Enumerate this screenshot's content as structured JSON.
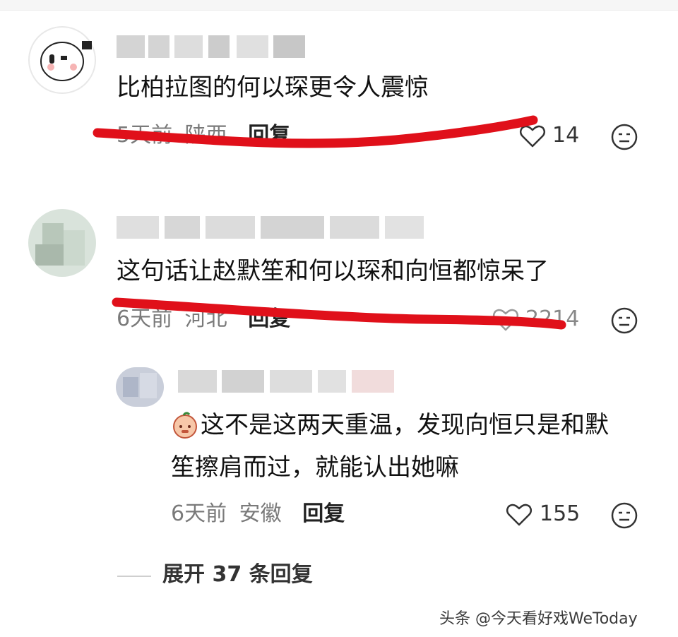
{
  "comments": [
    {
      "text": "比柏拉图的何以琛更令人震惊",
      "time": "5天前",
      "location": "陕西",
      "reply_label": "回复",
      "likes": "14",
      "like_icon": "heart-outline-icon",
      "emoji_icon": "emoji-face-icon"
    },
    {
      "text": "这句话让赵默笙和何以琛和向恒都惊呆了",
      "time": "6天前",
      "location": "河北",
      "reply_label": "回复",
      "likes": "2214",
      "like_icon": "heart-outline-icon",
      "emoji_icon": "emoji-face-icon"
    }
  ],
  "reply": {
    "text_line1": "这不是这两天重温，发现向恒只是和默",
    "text_line2": "笙擦肩而过，就能认出她嘛",
    "time": "6天前",
    "location": "安徽",
    "reply_label": "回复",
    "likes": "155",
    "like_icon": "heart-outline-icon",
    "emoji_icon": "emoji-face-icon",
    "sticker_icon": "peach-sticker-icon"
  },
  "expand_label": "展开 37 条回复",
  "watermark": "头条 @今天看好戏WeToday",
  "colors": {
    "annotation_red": "#e0101a",
    "meta_gray": "#7a7a7a"
  }
}
